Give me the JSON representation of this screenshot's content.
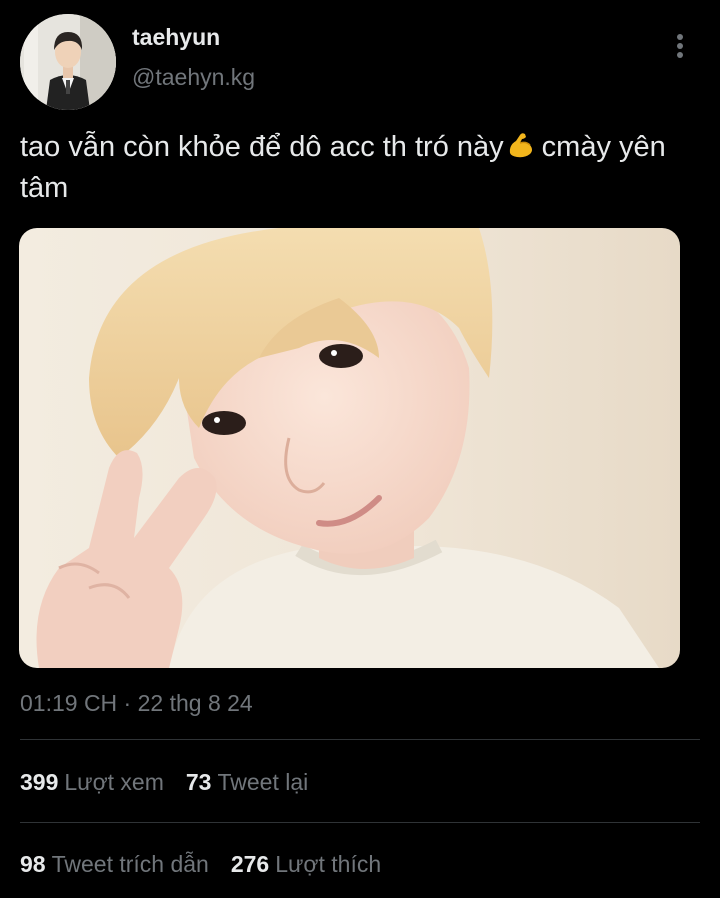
{
  "author": {
    "display_name": "taehyun",
    "handle": "@taehyn.kg",
    "avatar_icon": "profile-avatar"
  },
  "tweet": {
    "text_before_emoji": "tao vẫn còn khỏe để dô acc th tró này",
    "emoji_name": "flexed-biceps-icon",
    "text_after_emoji": "cmày yên tâm",
    "timestamp": "01:19 CH · 22 thg 8 24"
  },
  "stats": {
    "views_count": "399",
    "views_label": "Lượt xem",
    "retweets_count": "73",
    "retweets_label": "Tweet lại",
    "quotes_count": "98",
    "quotes_label": "Tweet trích dẫn",
    "likes_count": "276",
    "likes_label": "Lượt thích"
  },
  "colors": {
    "background": "#000000",
    "primary_text": "#e7e9ea",
    "secondary_text": "#71767b",
    "divider": "#2f3336",
    "emoji": "#f2b51c"
  }
}
